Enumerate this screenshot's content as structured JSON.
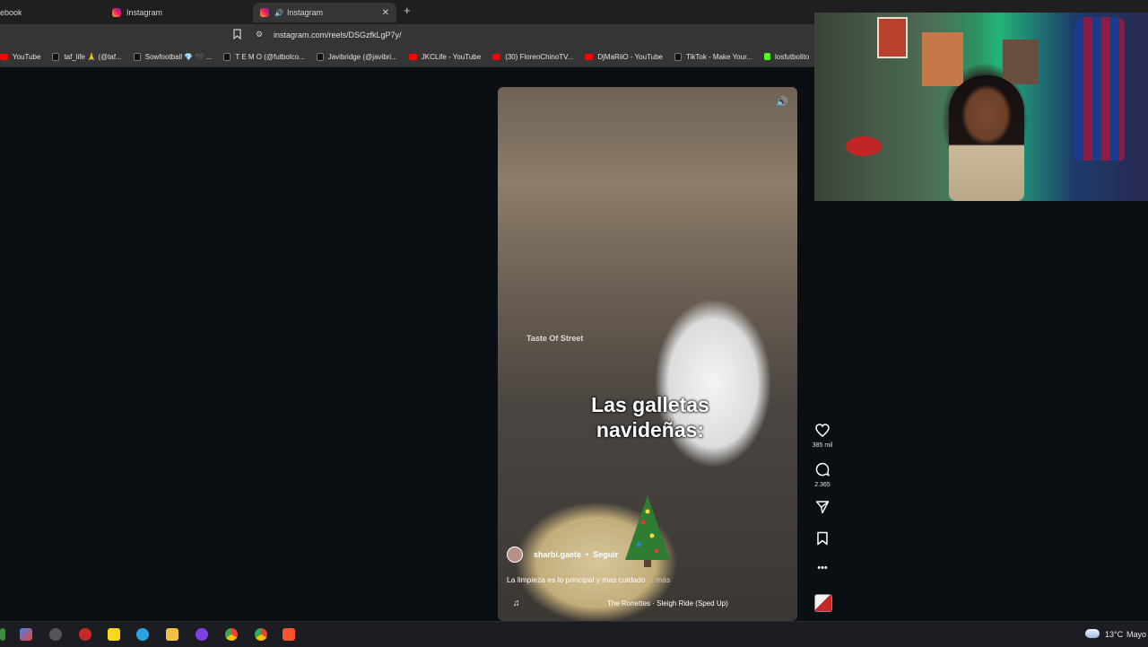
{
  "browser": {
    "tabs": [
      {
        "label": "ebook"
      },
      {
        "label": "Instagram"
      },
      {
        "label": "Instagram",
        "active": true
      }
    ],
    "close_glyph": "✕",
    "new_tab_glyph": "+",
    "url": "instagram.com/reels/DSGzfkLgP7y/",
    "bookmarks": [
      {
        "label": "YouTube",
        "icon": "youtube-icon"
      },
      {
        "label": "taf_life 🙏 (@taf...",
        "icon": "tiktok-icon"
      },
      {
        "label": "Sowfootball 💎 🖤 ...",
        "icon": "tiktok-icon"
      },
      {
        "label": "T E M O (@futbolco...",
        "icon": "tiktok-icon"
      },
      {
        "label": "Javibridge (@javibri...",
        "icon": "tiktok-icon"
      },
      {
        "label": "JKCLife - YouTube",
        "icon": "youtube-icon"
      },
      {
        "label": "(30) FlorenChinoTV...",
        "icon": "youtube-icon"
      },
      {
        "label": "DjMaRiiO - YouTube",
        "icon": "youtube-icon"
      },
      {
        "label": "TikTok - Make Your...",
        "icon": "tiktok-icon"
      },
      {
        "label": "losfutbolito",
        "icon": "kick-icon"
      }
    ]
  },
  "reel": {
    "watermark": "Taste Of Street",
    "caption_line1": "Las galletas",
    "caption_line2": "navideñas:",
    "author": "sharbi.gaete",
    "dot": "•",
    "follow": "Seguir",
    "description": "La limpieza es lo principal y mas cuidado",
    "more": " ... más",
    "music": "The Ronettes · Sleigh Ride (Sped Up)"
  },
  "actions": {
    "likes": "385 mil",
    "comments": "2.365",
    "more_glyph": "•••"
  },
  "taskbar": {
    "temperature": "13°C",
    "weather_text": "Mayo"
  },
  "colors": {
    "instagram_accent": "#e1306c",
    "youtube_red": "#ff0000",
    "kick_green": "#53fc18",
    "browser_chrome": "#353535"
  }
}
